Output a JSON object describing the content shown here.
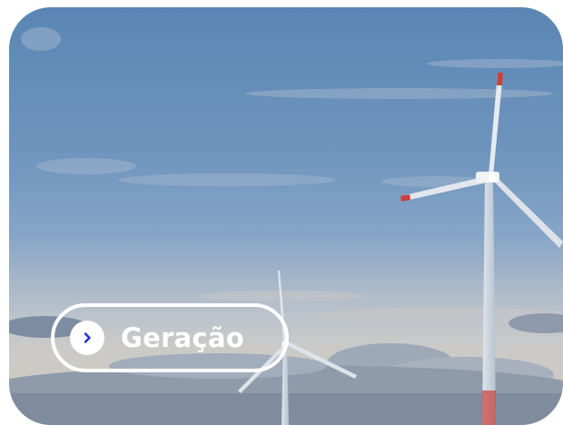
{
  "card": {
    "image_alt": "wind-turbines-photo",
    "cta": {
      "label": "Geração",
      "icon": "chevron-right-icon",
      "icon_color": "#1a2fd6"
    }
  }
}
